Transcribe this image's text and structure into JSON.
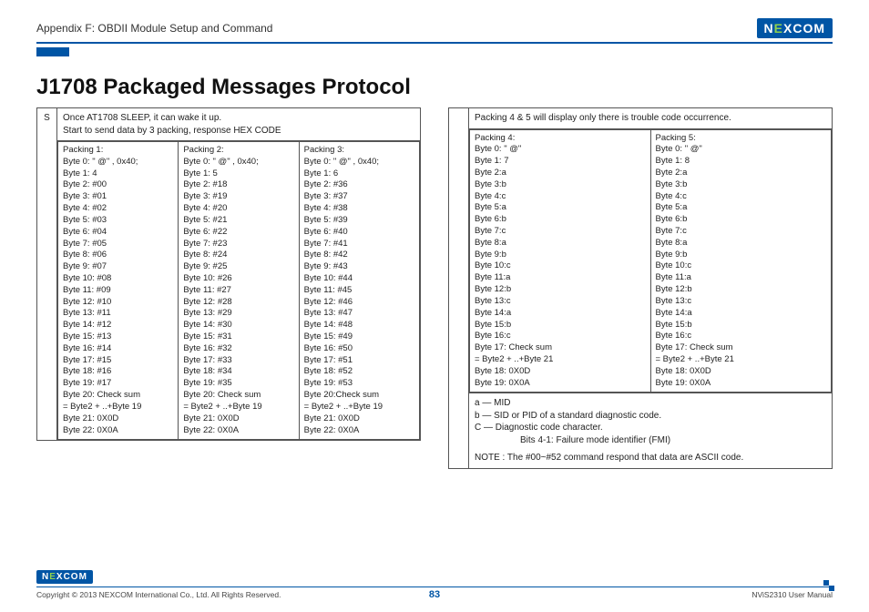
{
  "header": {
    "appendix": "Appendix F: OBDII Module Setup and Command",
    "brand_pre": "N",
    "brand_e": "E",
    "brand_post": "XCOM"
  },
  "title": "J1708 Packaged Messages Protocol",
  "left": {
    "side": "S",
    "note_l1": "Once AT1708 SLEEP, it can wake it up.",
    "note_l2": "Start to send data by 3 packing, response HEX CODE",
    "p1": {
      "h": "Packing 1:",
      "b0": "Byte 0: \" @\" , 0x40;",
      "b1": "Byte 1: 4",
      "b2": "Byte 2: #00",
      "b3": "Byte 3: #01",
      "b4": "Byte 4: #02",
      "b5": "Byte 5: #03",
      "b6": "Byte 6: #04",
      "b7": "Byte 7: #05",
      "b8": "Byte 8: #06",
      "b9": "Byte 9: #07",
      "b10": "Byte 10: #08",
      "b11": "Byte 11: #09",
      "b12": "Byte 12: #10",
      "b13": "Byte 13: #11",
      "b14": "Byte 14: #12",
      "b15": "Byte 15: #13",
      "b16": "Byte 16: #14",
      "b17": "Byte 17: #15",
      "b18": "Byte 18: #16",
      "b19": "Byte 19: #17",
      "b20": "Byte 20: Check sum",
      "eq": "= Byte2 + ..+Byte 19",
      "b21": "Byte 21: 0X0D",
      "b22": "Byte 22: 0X0A"
    },
    "p2": {
      "h": "Packing 2:",
      "b0": "Byte 0: \" @\" , 0x40;",
      "b1": "Byte 1: 5",
      "b2": "Byte 2: #18",
      "b3": "Byte 3: #19",
      "b4": "Byte 4: #20",
      "b5": "Byte 5: #21",
      "b6": "Byte 6: #22",
      "b7": "Byte 7: #23",
      "b8": "Byte 8: #24",
      "b9": "Byte 9: #25",
      "b10": "Byte 10: #26",
      "b11": "Byte 11: #27",
      "b12": "Byte 12: #28",
      "b13": "Byte 13: #29",
      "b14": "Byte 14: #30",
      "b15": "Byte 15: #31",
      "b16": "Byte 16: #32",
      "b17": "Byte 17: #33",
      "b18": "Byte 18: #34",
      "b19": "Byte 19: #35",
      "b20": "Byte 20: Check sum",
      "eq": "= Byte2 + ..+Byte 19",
      "b21": "Byte 21: 0X0D",
      "b22": "Byte 22: 0X0A"
    },
    "p3": {
      "h": "Packing 3:",
      "b0": "Byte 0: \" @\" , 0x40;",
      "b1": "Byte 1: 6",
      "b2": "Byte 2: #36",
      "b3": "Byte 3: #37",
      "b4": "Byte 4: #38",
      "b5": "Byte 5: #39",
      "b6": "Byte 6: #40",
      "b7": "Byte 7: #41",
      "b8": "Byte 8: #42",
      "b9": "Byte 9: #43",
      "b10": "Byte 10: #44",
      "b11": "Byte 11: #45",
      "b12": "Byte 12: #46",
      "b13": "Byte 13: #47",
      "b14": "Byte 14: #48",
      "b15": "Byte 15: #49",
      "b16": "Byte 16: #50",
      "b17": "Byte 17: #51",
      "b18": "Byte 18: #52",
      "b19": "Byte 19: #53",
      "b20": "Byte 20:Check sum",
      "eq": "= Byte2 + ..+Byte 19",
      "b21": "Byte 21: 0X0D",
      "b22": "Byte 22: 0X0A"
    }
  },
  "right": {
    "note": "Packing 4 & 5 will display only there is trouble code occurrence.",
    "p4": {
      "h": "Packing 4:",
      "b0": "Byte 0: \" @\"",
      "b1": "Byte 1: 7",
      "b2": "Byte 2:a",
      "b3": "Byte 3:b",
      "b4": "Byte 4:c",
      "b5": "Byte 5:a",
      "b6": "Byte 6:b",
      "b7": "Byte 7:c",
      "b8": "Byte 8:a",
      "b9": "Byte 9:b",
      "b10": "Byte 10:c",
      "b11": "Byte 11:a",
      "b12": "Byte 12:b",
      "b13": "Byte 13:c",
      "b14": "Byte 14:a",
      "b15": "Byte 15:b",
      "b16": "Byte 16:c",
      "b17": "Byte 17: Check sum",
      "eq": "= Byte2 + ..+Byte 21",
      "b18": "Byte 18: 0X0D",
      "b19": "Byte 19: 0X0A"
    },
    "p5": {
      "h": "Packing 5:",
      "b0": "Byte 0: \" @\"",
      "b1": "Byte 1: 8",
      "b2": "Byte 2:a",
      "b3": "Byte 3:b",
      "b4": "Byte 4:c",
      "b5": "Byte 5:a",
      "b6": "Byte 6:b",
      "b7": "Byte 7:c",
      "b8": "Byte 8:a",
      "b9": "Byte 9:b",
      "b10": "Byte 10:c",
      "b11": "Byte 11:a",
      "b12": "Byte 12:b",
      "b13": "Byte 13:c",
      "b14": "Byte 14:a",
      "b15": "Byte 15:b",
      "b16": "Byte 16:c",
      "b17": "Byte 17: Check sum",
      "eq": "= Byte2 + ..+Byte 21",
      "b18": "Byte 18: 0X0D",
      "b19": "Byte 19: 0X0A"
    },
    "legend": {
      "a": "a — MID",
      "b": "b — SID or PID of a standard diagnostic code.",
      "c": "C — Diagnostic code character.",
      "c2": "Bits 4-1: Failure mode identifier (FMI)",
      "note": "NOTE : The #00~#52 command respond that data are ASCII code."
    }
  },
  "footer": {
    "copyright": "Copyright © 2013 NEXCOM International Co., Ltd. All Rights Reserved.",
    "page": "83",
    "manual": "NViS2310 User Manual"
  }
}
